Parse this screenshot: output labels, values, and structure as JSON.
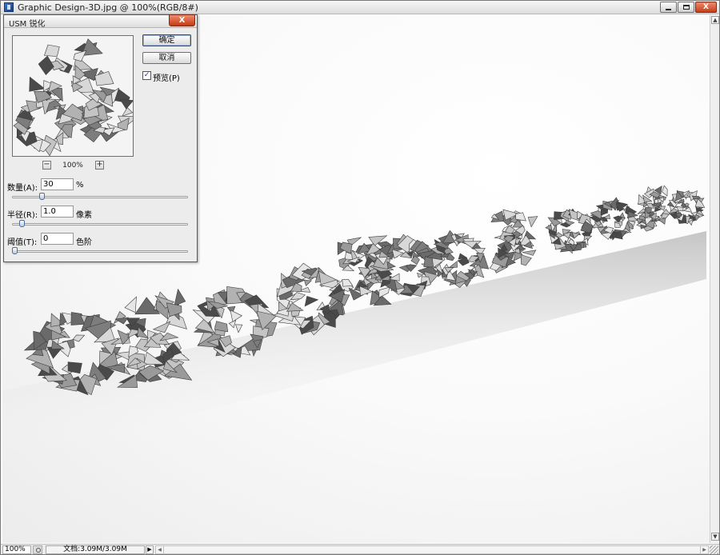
{
  "window": {
    "title": "Graphic Design-3D.jpg @ 100%(RGB/8#)",
    "min_glyph": "",
    "max_glyph": "",
    "close_glyph": "X"
  },
  "status": {
    "zoom": "100%",
    "doc_info": "文档:3.09M/3.09M",
    "info_arrow": "▶"
  },
  "dialog": {
    "title": "USM 锐化",
    "close_glyph": "X",
    "ok_label": "确定",
    "cancel_label": "取消",
    "preview_checked": "✓",
    "preview_label": "预览(P)",
    "preview_zoom": "100%",
    "zoom_out": "−",
    "zoom_in": "+",
    "amount": {
      "label": "数量(A):",
      "value": "30",
      "unit": "%",
      "slider_fraction": 0.16
    },
    "radius": {
      "label": "半径(R):",
      "value": "1.0",
      "unit": "像素",
      "slider_fraction": 0.04
    },
    "threshold": {
      "label": "阈值(T):",
      "value": "0",
      "unit": "色阶",
      "slider_fraction": 0.0
    }
  },
  "colors": {
    "accent": "#c63f1b",
    "art_light": "#d8d8d8",
    "art_mid": "#9a9a9a",
    "art_dark": "#4a4a4a"
  },
  "icons": {
    "doc": "photoshop-doc-icon",
    "status": "status-menu-icon"
  }
}
